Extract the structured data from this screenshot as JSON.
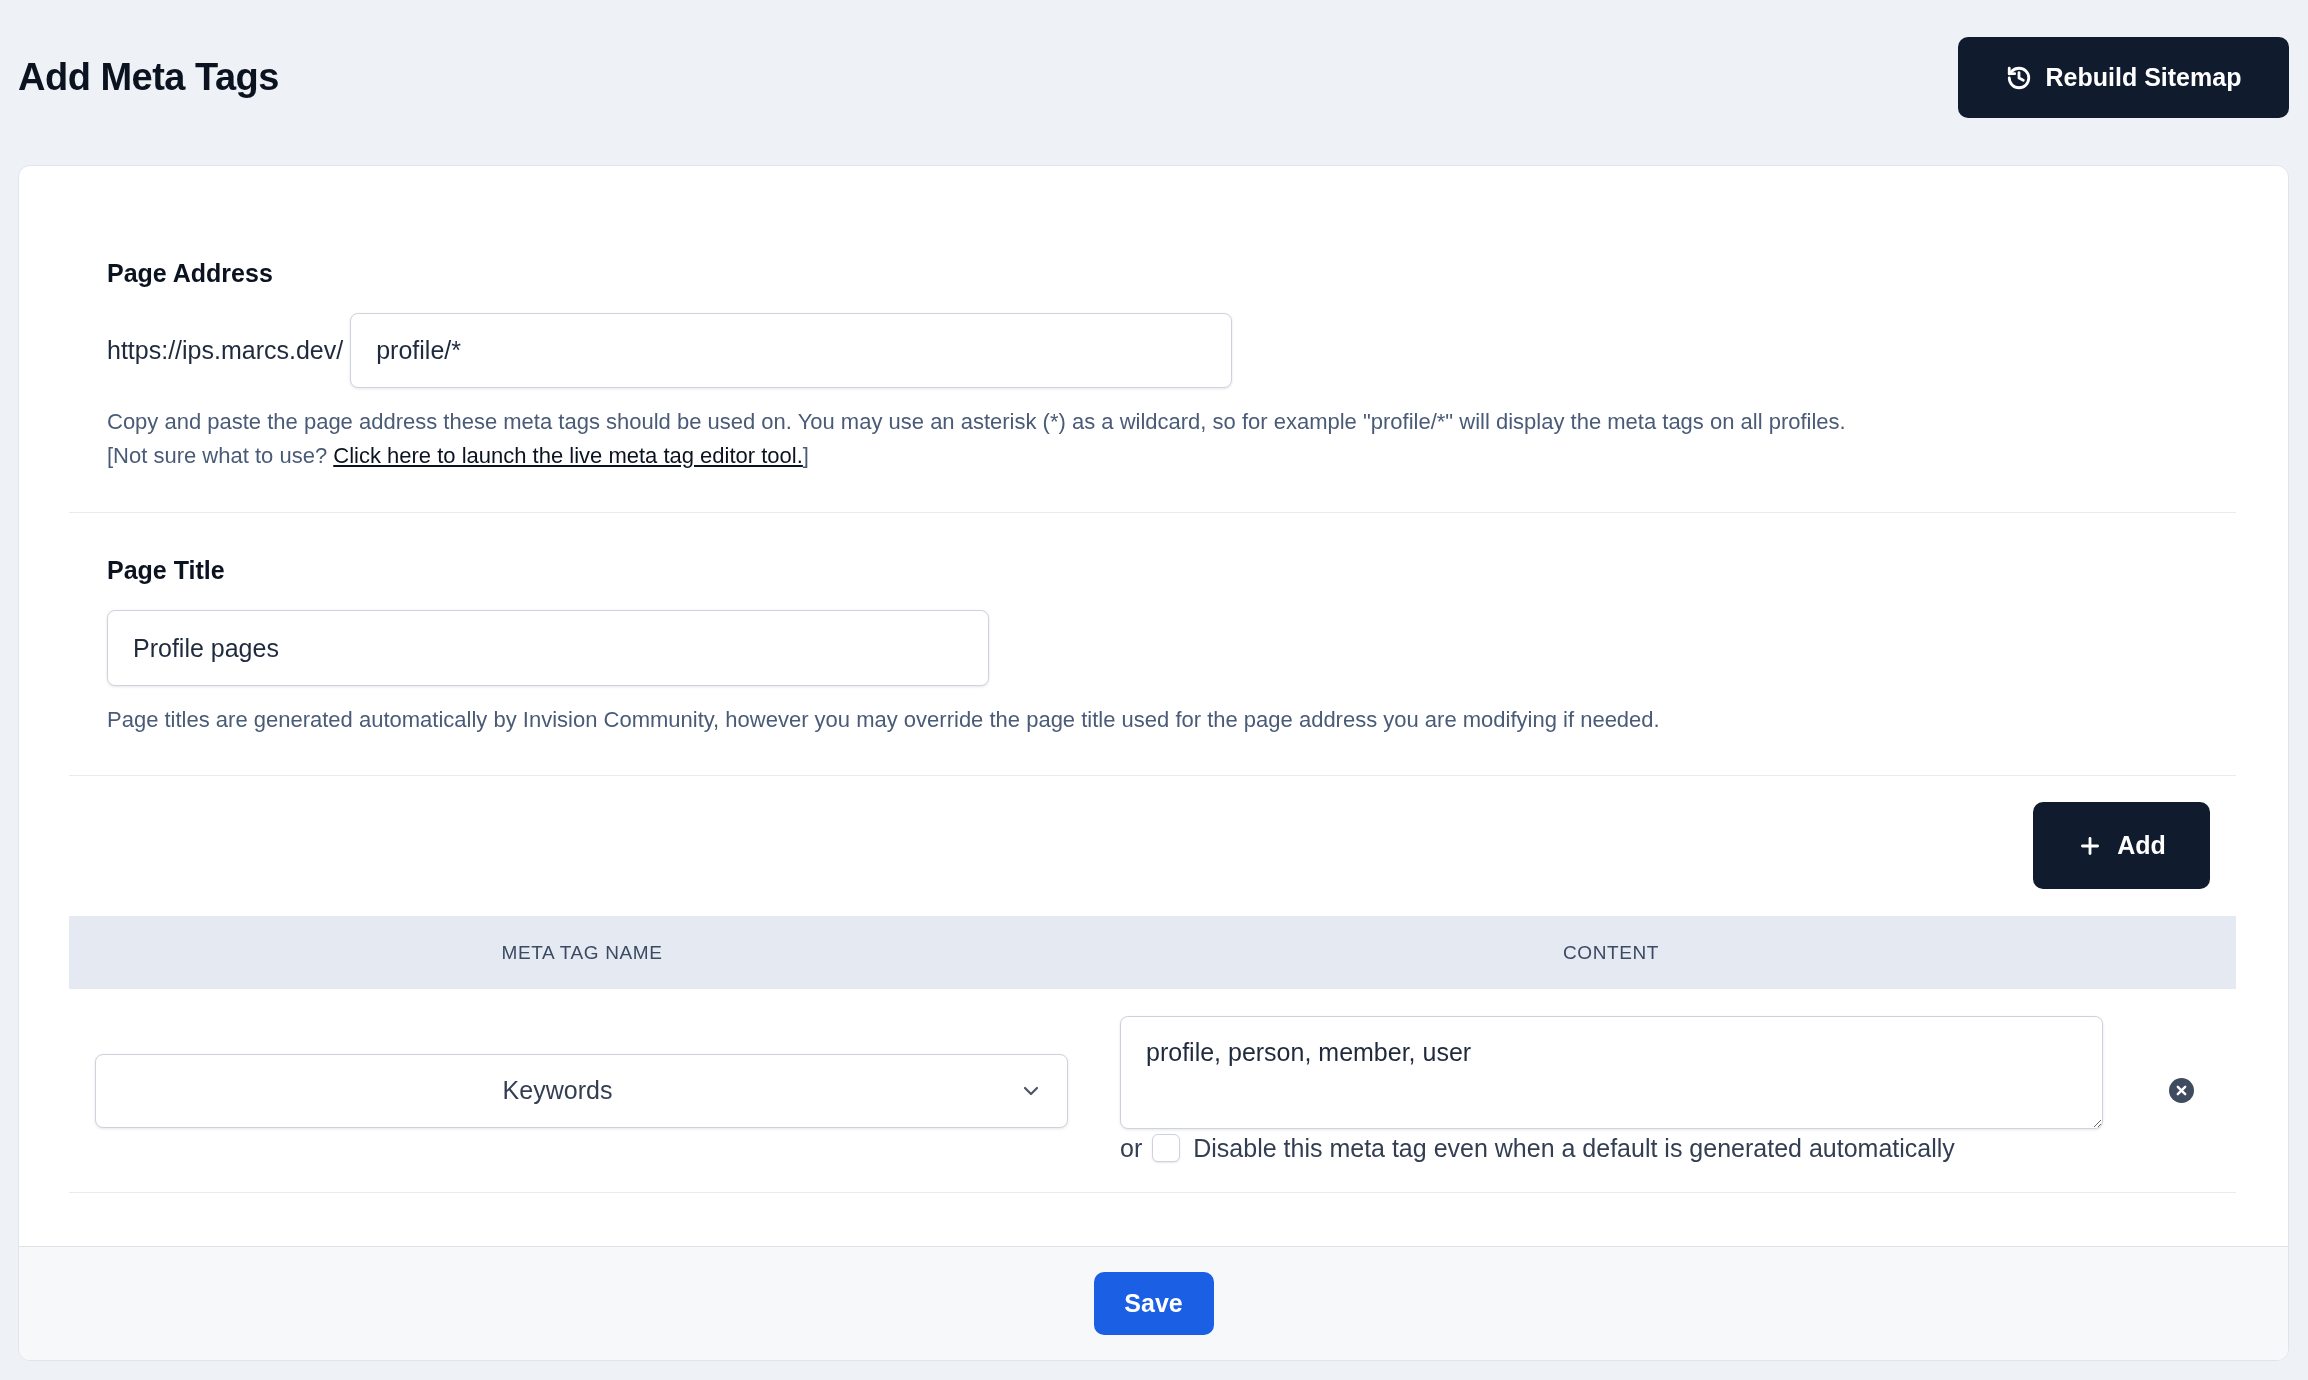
{
  "header": {
    "title": "Add Meta Tags",
    "rebuild_button": "Rebuild Sitemap"
  },
  "page_address": {
    "label": "Page Address",
    "prefix": "https://ips.marcs.dev/",
    "value": "profile/*",
    "help": "Copy and paste the page address these meta tags should be used on. You may use an asterisk (*) as a wildcard, so for example \"profile/*\" will display the meta tags on all profiles.",
    "note_before": "[Not sure what to use?",
    "link": "Click here to launch the live meta tag editor tool.",
    "note_after": "]"
  },
  "page_title": {
    "label": "Page Title",
    "value": "Profile pages",
    "help": "Page titles are generated automatically by Invision Community, however you may override the page title used for the page address you are modifying if needed."
  },
  "meta_tags": {
    "add_button": "Add",
    "columns": [
      "META TAG NAME",
      "CONTENT"
    ],
    "rows": [
      {
        "name": "Keywords",
        "content": "profile, person, member, user",
        "or_label": "or",
        "disable_label": "Disable this meta tag even when a default is generated automatically",
        "disable_checked": false
      }
    ]
  },
  "footer": {
    "save_button": "Save"
  }
}
